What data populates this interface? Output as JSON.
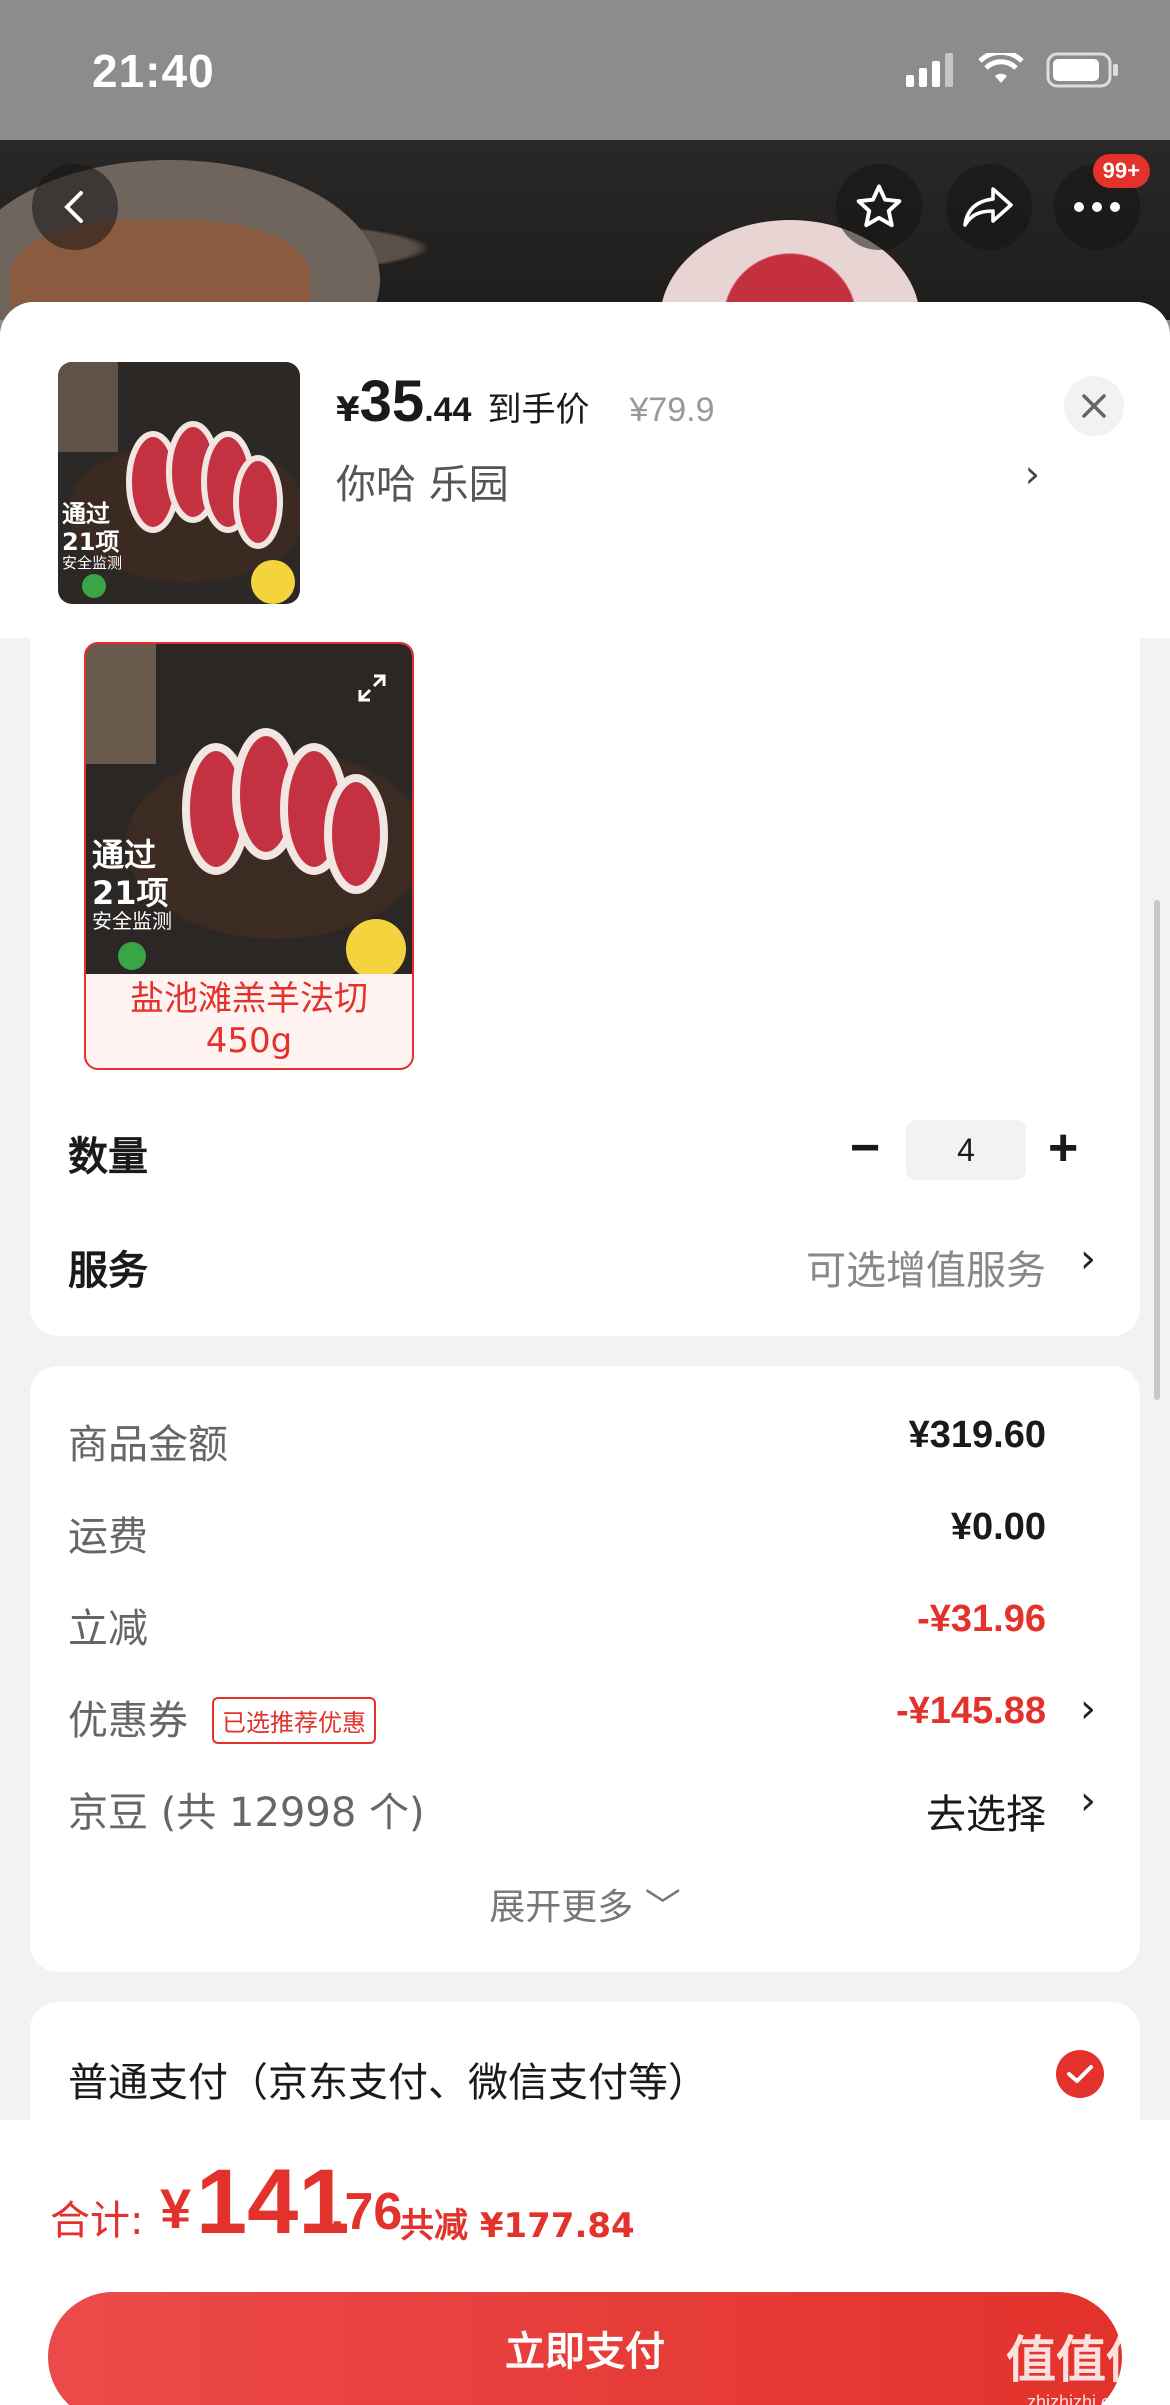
{
  "status_bar": {
    "time": "21:40"
  },
  "header_actions": {
    "notification_badge": "99+"
  },
  "sheet_header": {
    "currency": "¥",
    "price_int": "35",
    "price_dec": ".44",
    "price_tag": "到手价",
    "original_price": "¥79.9",
    "spec": "你哈  乐园",
    "spec_arrow": "›"
  },
  "sku": {
    "label_line1": "盐池滩羔羊法切",
    "label_line2": "450g",
    "image_text_line1": "通过",
    "image_text_line2": "21项",
    "image_text_line3": "安全监测"
  },
  "quantity": {
    "label": "数量",
    "minus": "−",
    "value": "4",
    "plus": "+"
  },
  "service": {
    "label": "服务",
    "value": "可选增值服务",
    "arrow": "›"
  },
  "fees": {
    "goods_label": "商品金额",
    "goods_value": "¥319.60",
    "shipping_label": "运费",
    "shipping_value": "¥0.00",
    "discount_label": "立减",
    "discount_value": "-¥31.96",
    "coupon_label": "优惠券",
    "coupon_badge": "已选推荐优惠",
    "coupon_value": "-¥145.88",
    "coupon_arrow": "›",
    "jd_beans_label": "京豆 (共 12998 个)",
    "jd_beans_value": "去选择",
    "jd_beans_arrow": "›",
    "expand": "展开更多 ﹀"
  },
  "payment": {
    "method": "普通支付（京东支付、微信支付等）"
  },
  "total": {
    "label": "合计:",
    "yen": "¥",
    "int": "141",
    "dec": ".76",
    "saved": "共减 ¥177.84"
  },
  "pay_button": {
    "label": "立即支付"
  },
  "watermark": {
    "text": "值值值",
    "sub": "zhizhizhi.com"
  },
  "colors": {
    "accent": "#e2322b",
    "sheet_bg": "#f2f2f2"
  }
}
